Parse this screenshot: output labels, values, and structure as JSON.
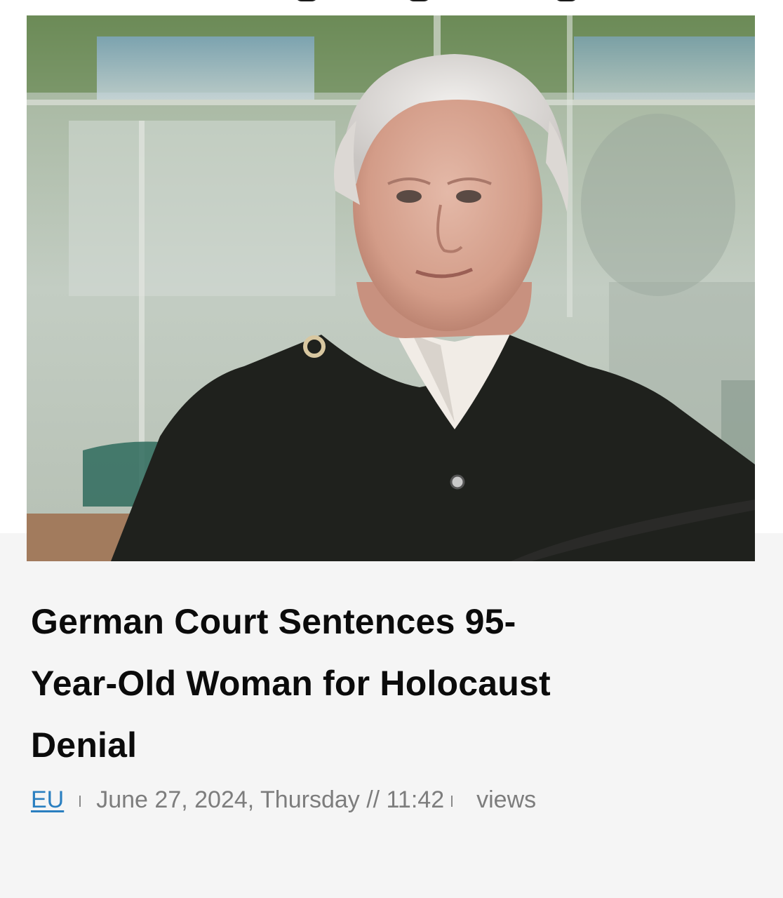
{
  "article": {
    "image": {
      "subject": "photo",
      "icon": "news-photo"
    },
    "headline_line1": "German Court Sentences 95-",
    "headline_line2": "Year-Old Woman for Holocaust",
    "headline_line3": "Denial",
    "meta": {
      "category": "EU",
      "date": "June 27, 2024, Thursday // 11:42",
      "views_label": "views"
    }
  },
  "colors": {
    "background": "#f5f5f5",
    "headline": "#0b0b0b",
    "meta_text": "#7d7d7d",
    "category_link": "#2a7fc0"
  }
}
